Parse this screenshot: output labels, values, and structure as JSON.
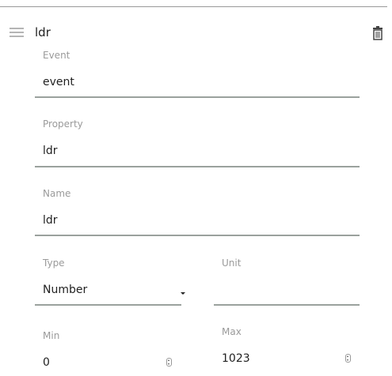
{
  "item": {
    "title": "ldr"
  },
  "icons": {
    "drag": "drag-handle-icon",
    "delete": "trash-icon"
  },
  "fields": {
    "event": {
      "label": "Event",
      "value": "event"
    },
    "property": {
      "label": "Property",
      "value": "ldr"
    },
    "name": {
      "label": "Name",
      "value": "ldr"
    },
    "type": {
      "label": "Type",
      "value": "Number"
    },
    "unit": {
      "label": "Unit",
      "value": ""
    },
    "min": {
      "label": "Min",
      "value": "0"
    },
    "max": {
      "label": "Max",
      "value": "1023"
    }
  },
  "colors": {
    "underline": "#9aa19d",
    "label": "#9a9a9a",
    "text": "#222222"
  }
}
